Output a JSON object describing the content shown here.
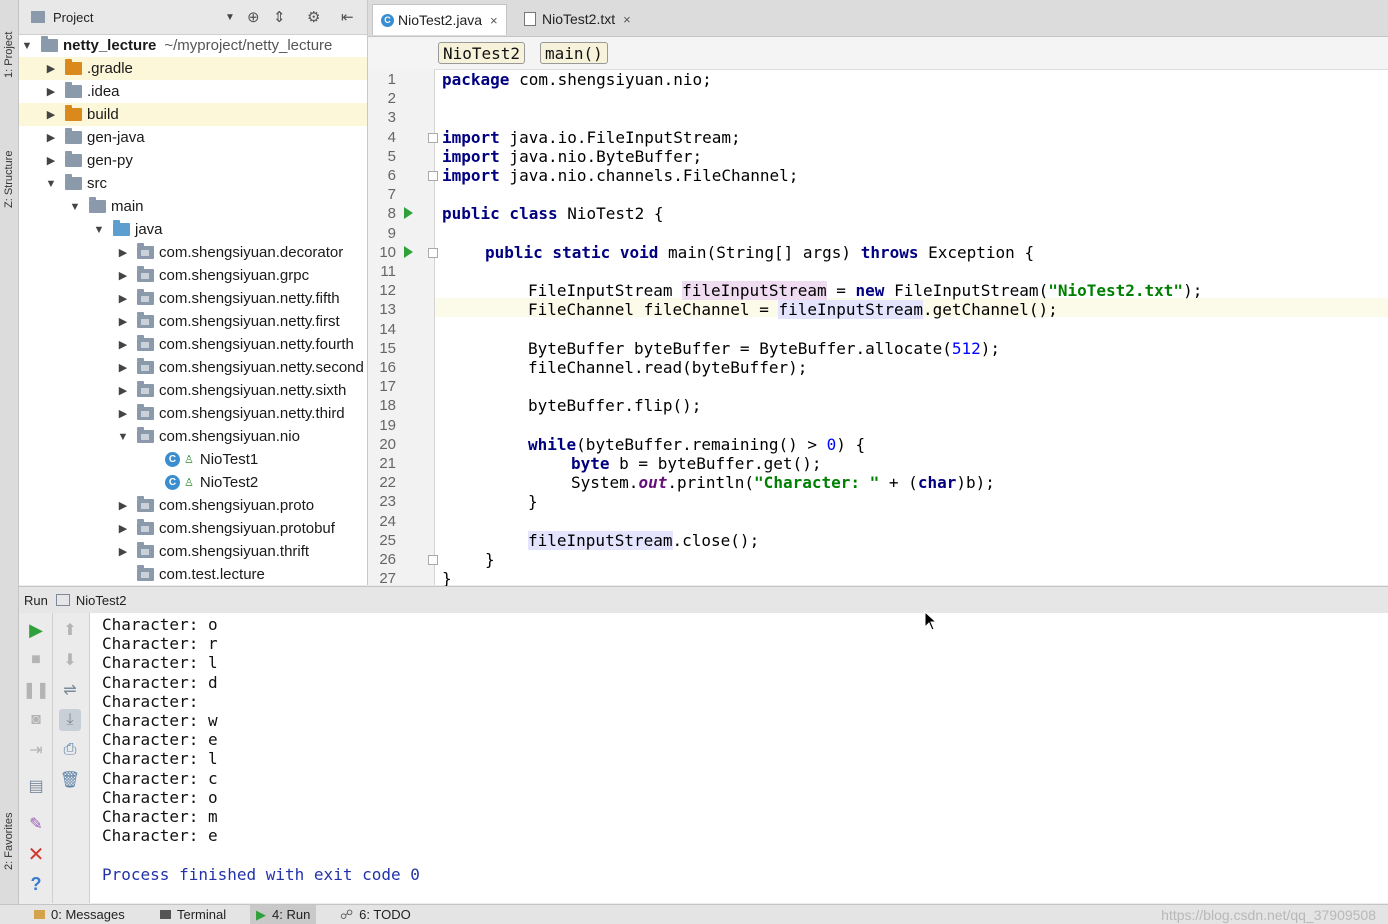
{
  "left_strip": {
    "project_tab": "1: Project",
    "structure_tab": "Z: Structure",
    "favorites_tab": "2: Favorites"
  },
  "project_panel": {
    "header_label": "Project",
    "root_name": "netty_lecture",
    "root_path": "~/myproject/netty_lecture",
    "items": [
      {
        "label": ".gradle"
      },
      {
        "label": ".idea"
      },
      {
        "label": "build"
      },
      {
        "label": "gen-java"
      },
      {
        "label": "gen-py"
      },
      {
        "label": "src"
      },
      {
        "label": "main"
      },
      {
        "label": "java"
      },
      {
        "label": "com.shengsiyuan.decorator"
      },
      {
        "label": "com.shengsiyuan.grpc"
      },
      {
        "label": "com.shengsiyuan.netty.fifth"
      },
      {
        "label": "com.shengsiyuan.netty.first"
      },
      {
        "label": "com.shengsiyuan.netty.fourth"
      },
      {
        "label": "com.shengsiyuan.netty.second"
      },
      {
        "label": "com.shengsiyuan.netty.sixth"
      },
      {
        "label": "com.shengsiyuan.netty.third"
      },
      {
        "label": "com.shengsiyuan.nio"
      },
      {
        "label": "NioTest1"
      },
      {
        "label": "NioTest2"
      },
      {
        "label": "com.shengsiyuan.proto"
      },
      {
        "label": "com.shengsiyuan.protobuf"
      },
      {
        "label": "com.shengsiyuan.thrift"
      },
      {
        "label": "com.test.lecture"
      }
    ]
  },
  "editor": {
    "tabs": [
      {
        "label": "NioTest2.java",
        "close": "×"
      },
      {
        "label": "NioTest2.txt",
        "close": "×"
      }
    ],
    "breadcrumbs": [
      "NioTest2",
      "main()"
    ],
    "line_numbers": [
      "1",
      "2",
      "3",
      "4",
      "5",
      "6",
      "7",
      "8",
      "9",
      "10",
      "11",
      "12",
      "13",
      "14",
      "15",
      "16",
      "17",
      "18",
      "19",
      "20",
      "21",
      "22",
      "23",
      "24",
      "25",
      "26",
      "27"
    ],
    "code": {
      "l1_kw": "package",
      "l1_rest": " com.shengsiyuan.nio;",
      "l4_kw": "import",
      "l4_rest": " java.io.FileInputStream;",
      "l5_kw": "import",
      "l5_rest": " java.nio.ByteBuffer;",
      "l6_kw": "import",
      "l6_rest": " java.nio.channels.FileChannel;",
      "l8_kw": "public class",
      "l8_rest": " NioTest2 {",
      "l10_kw1": "public static void",
      "l10_mid": " main(String[] args) ",
      "l10_kw2": "throws",
      "l10_rest": " Exception {",
      "l12_a": "FileInputStream ",
      "l12_var": "fileInputStream",
      "l12_b": " = ",
      "l12_kw": "new",
      "l12_c": " FileInputStream(",
      "l12_str": "\"NioTest2.txt\"",
      "l12_d": ");",
      "l13_a": "FileChannel fileChannel = ",
      "l13_var": "fileInputStream",
      "l13_b": ".getChannel();",
      "l15_a": "ByteBuffer byteBuffer = ByteBuffer.allocate(",
      "l15_num": "512",
      "l15_b": ");",
      "l16": "fileChannel.read(byteBuffer);",
      "l18": "byteBuffer.flip();",
      "l20_kw": "while",
      "l20_a": "(byteBuffer.remaining() > ",
      "l20_num": "0",
      "l20_b": ") {",
      "l21_kw": "byte",
      "l21_a": " b = byteBuffer.get();",
      "l22_a": "System.",
      "l22_fld": "out",
      "l22_b": ".println(",
      "l22_str": "\"Character: \"",
      "l22_c": " + (",
      "l22_kw": "char",
      "l22_d": ")b);",
      "l23": "}",
      "l25_var": "fileInputStream",
      "l25_a": ".close();",
      "l26": "}",
      "l27": "}"
    }
  },
  "run_panel": {
    "label": "Run",
    "config_name": "NioTest2",
    "output": [
      "Character: o",
      "Character: r",
      "Character: l",
      "Character: d",
      "Character:  ",
      "Character: w",
      "Character: e",
      "Character: l",
      "Character: c",
      "Character: o",
      "Character: m",
      "Character: e"
    ],
    "exit_message": "Process finished with exit code 0"
  },
  "bottom_bar": {
    "tabs": [
      "0: Messages",
      "Terminal",
      "4: Run",
      "6: TODO"
    ],
    "watermark": "https://blog.csdn.net/qq_37909508"
  }
}
